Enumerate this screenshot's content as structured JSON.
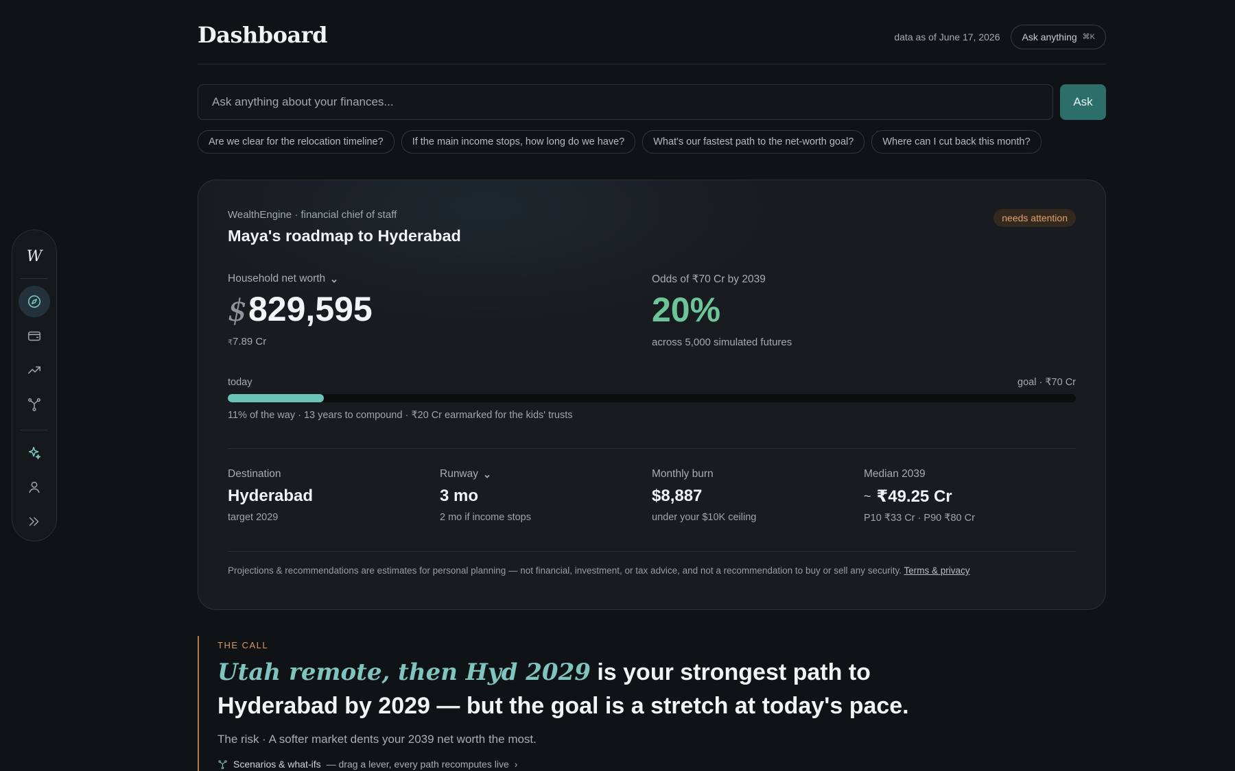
{
  "sidebar": {
    "logo": "W",
    "items": [
      {
        "name": "compass-icon",
        "active": true
      },
      {
        "name": "wallet-icon"
      },
      {
        "name": "trend-up-icon"
      },
      {
        "name": "branch-icon"
      },
      {
        "name": "sparkle-icon"
      },
      {
        "name": "user-icon"
      },
      {
        "name": "chevrons-right-icon"
      }
    ]
  },
  "header": {
    "title": "Dashboard",
    "as_of": "data as of June 17, 2026",
    "ask_pill": "Ask anything",
    "ask_kbd": "⌘K"
  },
  "search": {
    "placeholder": "Ask anything about your finances...",
    "button": "Ask",
    "chips": [
      "Are we clear for the relocation timeline?",
      "If the main income stops, how long do we have?",
      "What's our fastest path to the net-worth goal?",
      "Where can I cut back this month?"
    ]
  },
  "card": {
    "eyebrow": "WealthEngine · financial chief of staff",
    "title": "Maya's roadmap to Hyderabad",
    "badge": "needs attention",
    "net_worth": {
      "label": "Household net worth",
      "currency": "$",
      "value": "829,595",
      "sub_currency": "₹",
      "sub": "7.89 Cr"
    },
    "odds": {
      "label": "Odds of ₹70 Cr by 2039",
      "value": "20%",
      "sub": "across 5,000 simulated futures"
    },
    "progress": {
      "left_label": "today",
      "right_label": "goal · ₹70 Cr",
      "fraction": 0.113,
      "note": "11% of the way · 13 years to compound · ₹20 Cr earmarked for the kids' trusts"
    },
    "stats": [
      {
        "label": "Destination",
        "value": "Hyderabad",
        "sub": "target 2029"
      },
      {
        "label": "Runway",
        "value": "3 mo",
        "sub": "2 mo if income stops"
      },
      {
        "label": "Monthly burn",
        "value": "$8,887",
        "sub": "under your $10K ceiling"
      },
      {
        "label": "Median 2039",
        "prefix": "~",
        "value": "₹49.25 Cr",
        "sub": "P10 ₹33 Cr · P90 ₹80 Cr"
      }
    ],
    "disclaimer": "Projections & recommendations are estimates for personal planning — not financial, investment, or tax advice, and not a recommendation to buy or sell any security.",
    "terms_link": "Terms & privacy"
  },
  "call": {
    "kicker": "THE CALL",
    "headline_em": "Utah remote, then Hyd 2029",
    "headline_rest": " is your strongest path to Hyderabad by 2029 — but the goal is a stretch at today's pace.",
    "risk": "The risk · A softer market dents your 2039 net worth the most.",
    "scenarios_label": "Scenarios & what-ifs",
    "scenarios_desc": "— drag a lever, every path recomputes live",
    "scenarios_arrow": "›"
  },
  "colors": {
    "accent_teal": "#2c6f6a",
    "progress_fill": "#6cc2b7",
    "odds_green": "#6cc498",
    "badge_orange": "#e3a16a",
    "call_border": "#b57a4c"
  }
}
